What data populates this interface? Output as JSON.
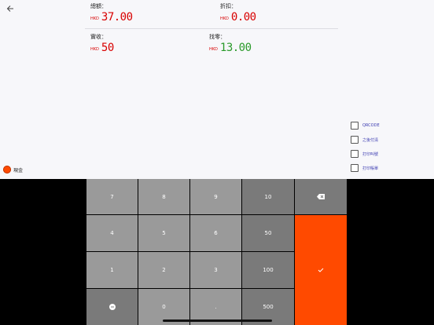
{
  "summary": {
    "total": {
      "label": "總額：",
      "currency": "HKD",
      "value": "37.00"
    },
    "discount": {
      "label": "折扣：",
      "currency": "HKD",
      "value": "0.00"
    },
    "received": {
      "label": "實收：",
      "currency": "HKD",
      "value": "50"
    },
    "change": {
      "label": "找零：",
      "currency": "HKD",
      "value": "13.00"
    }
  },
  "options": [
    {
      "label": "QRCODE",
      "checked": false
    },
    {
      "label": "之後付清",
      "checked": false
    },
    {
      "label": "打印叫號",
      "checked": false
    },
    {
      "label": "打印賬單",
      "checked": false
    }
  ],
  "payment_method": {
    "label": "現金",
    "selected": true
  },
  "keypad": {
    "k7": "7",
    "k8": "8",
    "k9": "9",
    "k10": "10",
    "k4": "4",
    "k5": "5",
    "k6": "6",
    "k50": "50",
    "k1": "1",
    "k2": "2",
    "k3": "3",
    "k100": "100",
    "k0": "0",
    "kdot": ".",
    "k500": "500"
  },
  "colors": {
    "accent": "#ff4a00",
    "amount_red": "#d80000",
    "amount_green": "#2a9a2a"
  }
}
